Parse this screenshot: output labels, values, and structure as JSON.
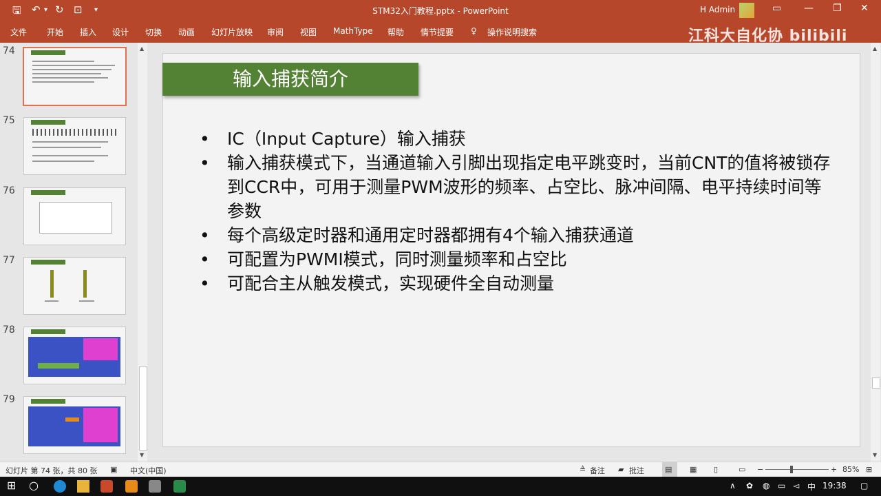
{
  "app": {
    "title": "STM32入门教程.pptx  -  PowerPoint",
    "user": "H Admin",
    "watermark": "江科大自化协 bilibili"
  },
  "ribbon": {
    "tabs": [
      "文件",
      "开始",
      "插入",
      "设计",
      "切换",
      "动画",
      "幻灯片放映",
      "审阅",
      "视图",
      "MathType",
      "帮助",
      "情节提要"
    ],
    "search": "操作说明搜索"
  },
  "thumbnails": [
    {
      "num": "74",
      "selected": true
    },
    {
      "num": "75",
      "selected": false
    },
    {
      "num": "76",
      "selected": false
    },
    {
      "num": "77",
      "selected": false
    },
    {
      "num": "78",
      "selected": false
    },
    {
      "num": "79",
      "selected": false
    }
  ],
  "slide": {
    "title": "输入捕获简介",
    "bullets": [
      "IC（Input Capture）输入捕获",
      "输入捕获模式下，当通道输入引脚出现指定电平跳变时，当前CNT的值将被锁存到CCR中，可用于测量PWM波形的频率、占空比、脉冲间隔、电平持续时间等参数",
      "每个高级定时器和通用定时器都拥有4个输入捕获通道",
      "可配置为PWMI模式，同时测量频率和占空比",
      "可配合主从触发模式，实现硬件全自动测量"
    ]
  },
  "status": {
    "slide_info": "幻灯片 第 74 张，共 80 张",
    "language": "中文(中国)",
    "notes": "备注",
    "comments": "批注",
    "zoom": "85%"
  },
  "taskbar": {
    "ime": "中",
    "time": "19:38"
  },
  "colors": {
    "ribbon": "#b7472a",
    "title_bar_fill": "#548235"
  }
}
